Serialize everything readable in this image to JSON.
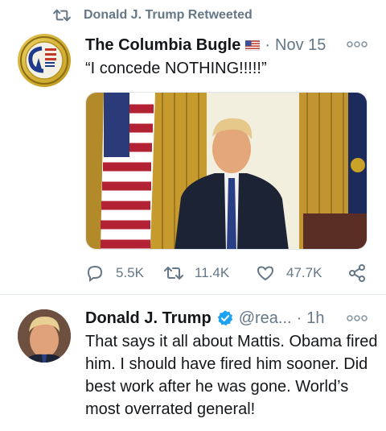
{
  "retweet_banner": {
    "text": "Donald J. Trump Retweeted",
    "icon": "retweet-icon"
  },
  "tweet1": {
    "author_name": "The Columbia Bugle",
    "badge_icon": "us-flag-icon",
    "separator": "·",
    "date": "Nov 15",
    "text": "“I concede NOTHING!!!!!”",
    "media_icon": "photo",
    "actions": {
      "reply_count": "5.5K",
      "retweet_count": "11.4K",
      "like_count": "47.7K"
    }
  },
  "tweet2": {
    "author_name": "Donald J. Trump",
    "handle": "@rea...",
    "separator": "·",
    "time": "1h",
    "text": "That says it all about Mattis. Obama fired him. I should have fired him sooner. Did best work after he was gone. World’s most overrated general!"
  },
  "colors": {
    "secondary_text": "#657786",
    "verified": "#1da1f2",
    "divider": "#e1e8ed"
  }
}
